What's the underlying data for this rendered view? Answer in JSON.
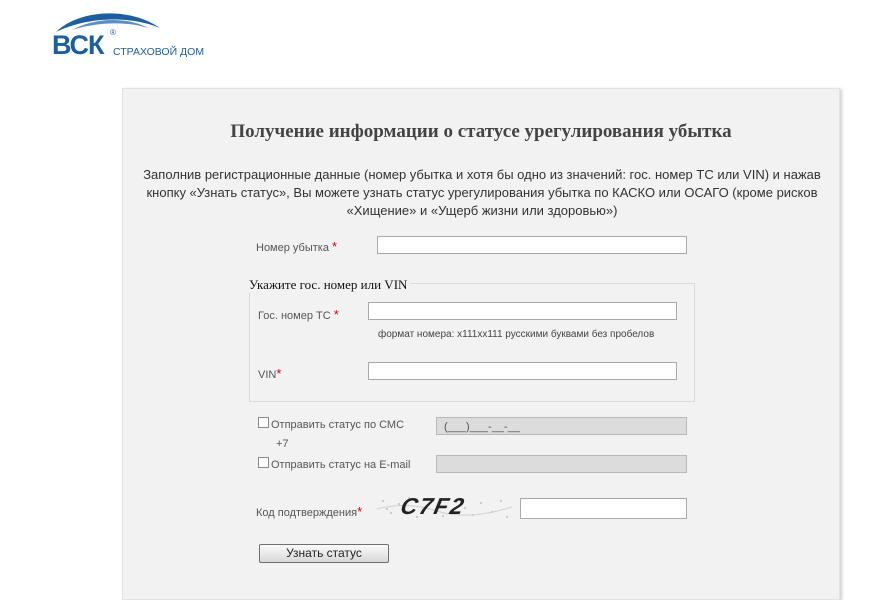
{
  "logo": {
    "brand": "ВСК",
    "registered": "®",
    "subtitle": "СТРАХОВОЙ ДОМ"
  },
  "form": {
    "title": "Получение информации о статусе урегулирования убытка",
    "intro": "Заполнив регистрационные данные (номер убытка и хотя бы одно из значений: гос. номер ТС или VIN) и нажав кнопку «Узнать статус», Вы можете узнать статус урегулирования убытка по КАСКО или ОСАГО (кроме рисков «Хищение» и «Ущерб жизни или здоровью»)",
    "claim_number_label": "Номер убытка",
    "claim_number_value": "",
    "required_mark": "*",
    "vehicle_group_legend": "Укажите гос. номер или VIN",
    "plate_label": "Гос. номер ТС",
    "plate_value": "",
    "plate_hint": "формат номера: х111хх111 русскими буквами без пробелов",
    "vin_label": "VIN",
    "vin_value": "",
    "sms_label": "Отправить статус по СМС",
    "sms_prefix": "+7",
    "sms_checked": false,
    "sms_value": "(___)___-__-__",
    "email_label": "Отправить статус на E-mail",
    "email_checked": false,
    "email_value": "",
    "confirm_label": "Код подтверждения",
    "captcha_text": "C7F2",
    "confirm_value": "",
    "submit_label": "Узнать статус"
  }
}
